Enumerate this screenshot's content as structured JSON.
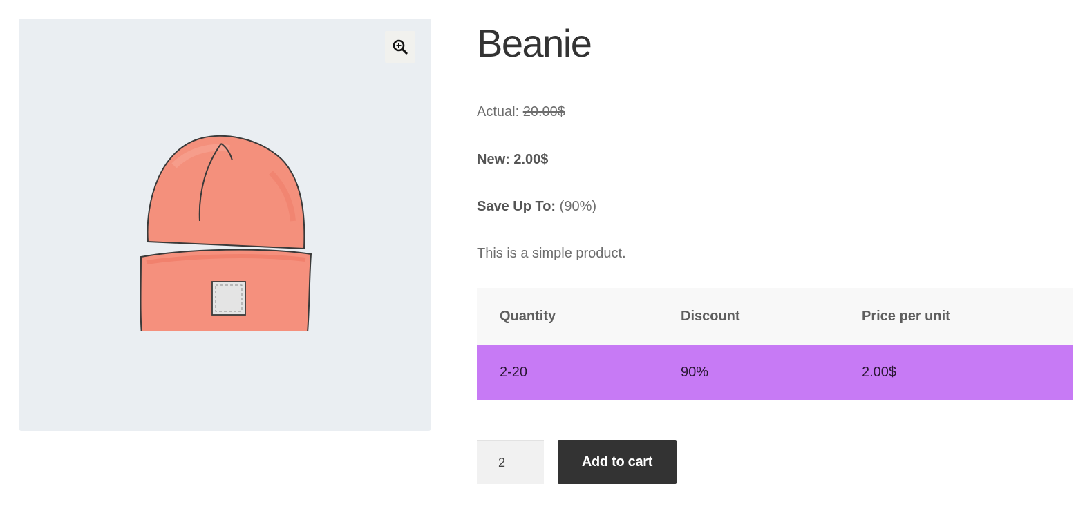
{
  "product": {
    "title": "Beanie",
    "actual_label": "Actual:",
    "actual_price": "20.00$",
    "new_label": "New: 2.00$",
    "save_label": "Save Up To:",
    "save_value": "(90%)",
    "description": "This is a simple product."
  },
  "gallery": {
    "zoom_icon": "zoom-in-icon",
    "image_icon": "beanie-image",
    "background": "#eaeef2"
  },
  "tier_table": {
    "headers": [
      "Quantity",
      "Discount",
      "Price per unit"
    ],
    "rows": [
      [
        "2-20",
        "90%",
        "2.00$"
      ]
    ],
    "highlight_color": "#c77af5"
  },
  "cart": {
    "quantity": "2",
    "add_to_cart_label": "Add to cart"
  }
}
